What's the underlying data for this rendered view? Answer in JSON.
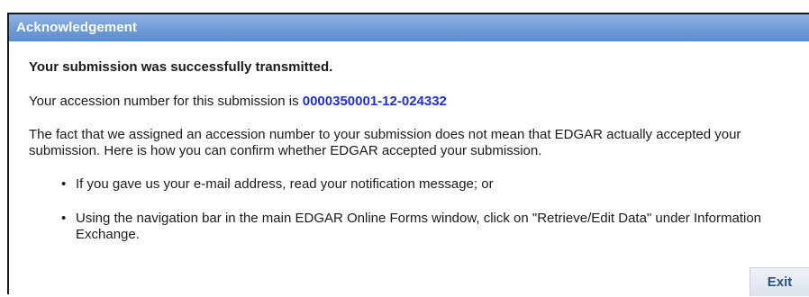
{
  "dialog": {
    "title": "Acknowledgement",
    "headline": "Your submission was successfully transmitted.",
    "accession_prefix": "Your accession number for this submission is ",
    "accession_number": "0000350001-12-024332",
    "notice": "The fact that we assigned an accession number to your submission does not mean that EDGAR actually accepted your submission. Here is how you can confirm whether EDGAR accepted your submission.",
    "bullets": [
      "If you gave us your e-mail address, read your notification message; or",
      "Using the navigation bar in the main EDGAR Online Forms window, click on \"Retrieve/Edit Data\" under Information Exchange."
    ],
    "exit_label": "Exit",
    "colors": {
      "title_bar": "#6f9bd6",
      "accession_number": "#1f2fd6",
      "exit_text": "#2a4f86"
    }
  }
}
